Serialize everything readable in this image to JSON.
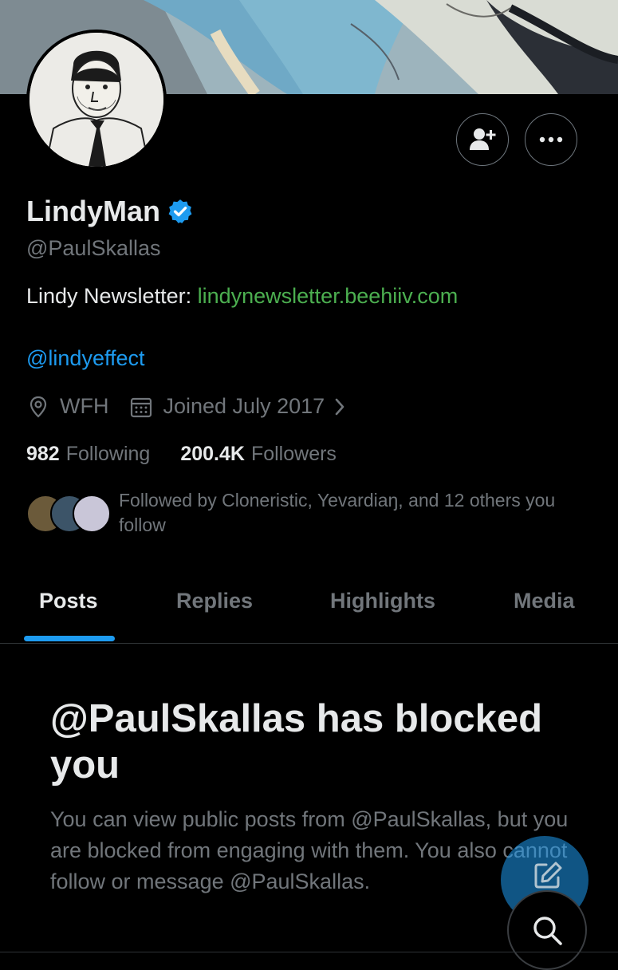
{
  "profile": {
    "name": "LindyMan",
    "handle": "@PaulSkallas",
    "bio_prefix": "Lindy Newsletter: ",
    "bio_link": "lindynewsletter.beehiiv.com",
    "mention": "@lindyeffect",
    "location": "WFH",
    "joined": "Joined July 2017",
    "following_count": "982",
    "following_label": "Following",
    "followers_count": "200.4K",
    "followers_label": "Followers",
    "followed_by": "Followed by Cloneristic, Yevardiaŋ, and 12 others you follow"
  },
  "tabs": [
    {
      "label": "Posts",
      "active": true
    },
    {
      "label": "Replies",
      "active": false
    },
    {
      "label": "Highlights",
      "active": false
    },
    {
      "label": "Media",
      "active": false
    }
  ],
  "blocked": {
    "title": "@PaulSkallas has blocked you",
    "body": "You can view public posts from @PaulSkallas, but you are blocked from engaging with them. You also cannot follow or message @PaulSkallas."
  },
  "icons": {
    "follow": "person-plus-icon",
    "more": "more-horizontal-icon",
    "verified": "verified-badge-icon",
    "location": "location-pin-icon",
    "calendar": "calendar-icon",
    "chevron": "chevron-right-icon",
    "compose": "compose-icon",
    "search": "search-icon"
  },
  "colors": {
    "background": "#000000",
    "accent": "#1d9bf0",
    "link": "#4caf50",
    "muted": "#71767b",
    "text": "#e7e9ea"
  }
}
